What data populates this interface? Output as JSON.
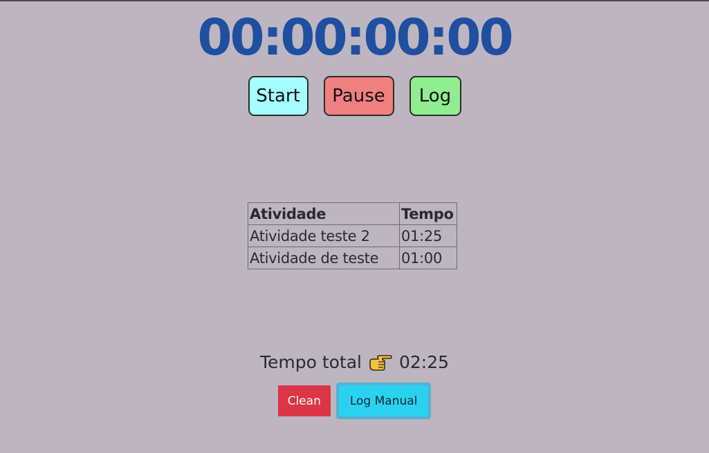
{
  "stopwatch": {
    "display": "00:00:00:00"
  },
  "controls": {
    "start_label": "Start",
    "pause_label": "Pause",
    "log_label": "Log"
  },
  "log_table": {
    "headers": [
      "Atividade",
      "Tempo"
    ],
    "rows": [
      {
        "activity": "Atividade teste 2",
        "time": "01:25"
      },
      {
        "activity": "Atividade de teste",
        "time": "01:00"
      }
    ]
  },
  "total": {
    "label": "Tempo total",
    "icon": "pointing-hand-icon",
    "value": "02:25"
  },
  "actions": {
    "clean_label": "Clean",
    "manual_log_label": "Log Manual"
  },
  "colors": {
    "background": "#bdb6c1",
    "timer": "#1f4fa0",
    "start": "#a6fdfd",
    "pause": "#f08080",
    "log": "#90ee90",
    "clean": "#dc3545",
    "manual_log": "#2bd1f0"
  }
}
